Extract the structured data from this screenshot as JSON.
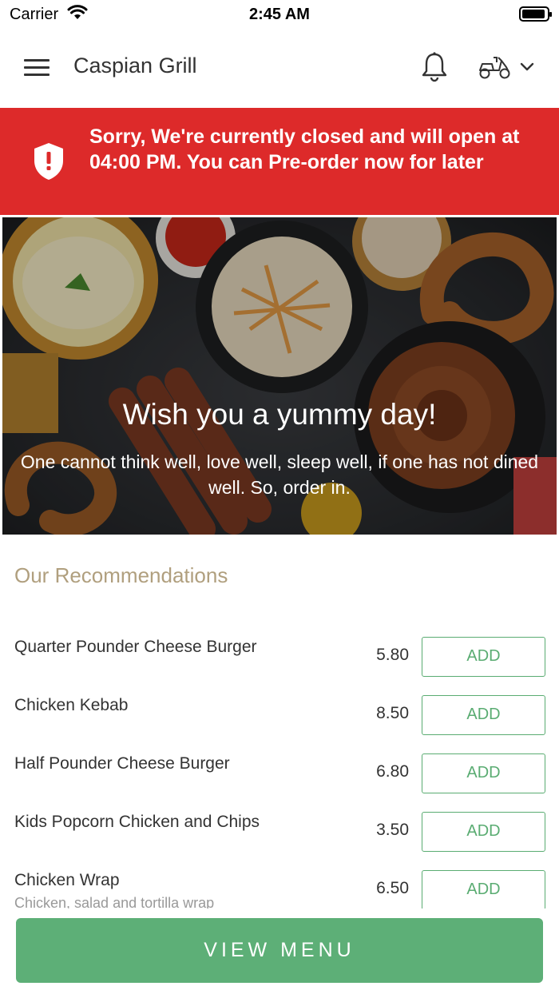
{
  "status_bar": {
    "carrier": "Carrier",
    "time": "2:45 AM"
  },
  "header": {
    "title": "Caspian Grill"
  },
  "banner": {
    "message": "Sorry, We're currently closed and will open at 04:00 PM. You can Pre-order now for later"
  },
  "hero": {
    "title": "Wish you a yummy day!",
    "subtitle": "One cannot think well, love well, sleep well, if one has not dined well. So, order in."
  },
  "recommendations": {
    "title": "Our Recommendations",
    "add_label": "ADD",
    "items": [
      {
        "name": "Quarter Pounder Cheese Burger",
        "price": "5.80",
        "description": ""
      },
      {
        "name": "Chicken Kebab",
        "price": "8.50",
        "description": ""
      },
      {
        "name": "Half Pounder Cheese Burger",
        "price": "6.80",
        "description": ""
      },
      {
        "name": "Kids Popcorn Chicken and Chips",
        "price": "3.50",
        "description": ""
      },
      {
        "name": "Chicken Wrap",
        "price": "6.50",
        "description": "Chicken, salad and tortilla wrap"
      }
    ]
  },
  "footer": {
    "view_menu_label": "VIEW MENU"
  },
  "colors": {
    "alert": "#dd2a2a",
    "accent_green": "#5aac72",
    "section_title": "#b09f7e"
  }
}
